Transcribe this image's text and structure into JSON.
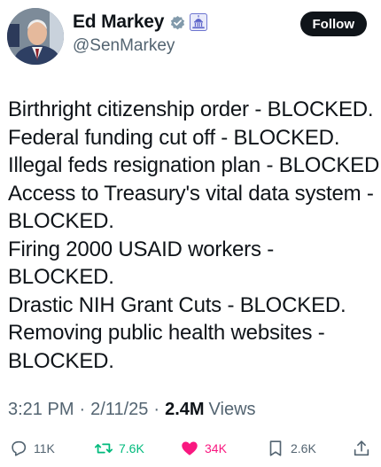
{
  "user": {
    "display_name": "Ed Markey",
    "handle": "@SenMarkey",
    "verified_icon": "verified-badge-icon",
    "affiliation_icon": "capitol-building-icon"
  },
  "follow_label": "Follow",
  "tweet": {
    "lines": [
      "Birthright citizenship order - BLOCKED.",
      "Federal funding cut off - BLOCKED.",
      "Illegal feds resignation plan - BLOCKED.",
      "Access to Treasury's vital data system -",
      "BLOCKED.",
      "Firing 2000 USAID workers -",
      "BLOCKED.",
      "Drastic NIH Grant Cuts - BLOCKED.",
      "Removing public health websites -",
      "BLOCKED."
    ]
  },
  "meta": {
    "time": "3:21 PM",
    "date": "2/11/25",
    "views_count": "2.4M",
    "views_label": "Views",
    "separator": "·"
  },
  "actions": {
    "replies": "11K",
    "reposts": "7.6K",
    "likes": "34K",
    "bookmarks": "2.6K"
  },
  "colors": {
    "text": "#0f1419",
    "muted": "#536471",
    "verified": "#829aab",
    "gov": "#5b63c9",
    "repost_active": "#00ba7c",
    "like_active": "#f91880"
  }
}
